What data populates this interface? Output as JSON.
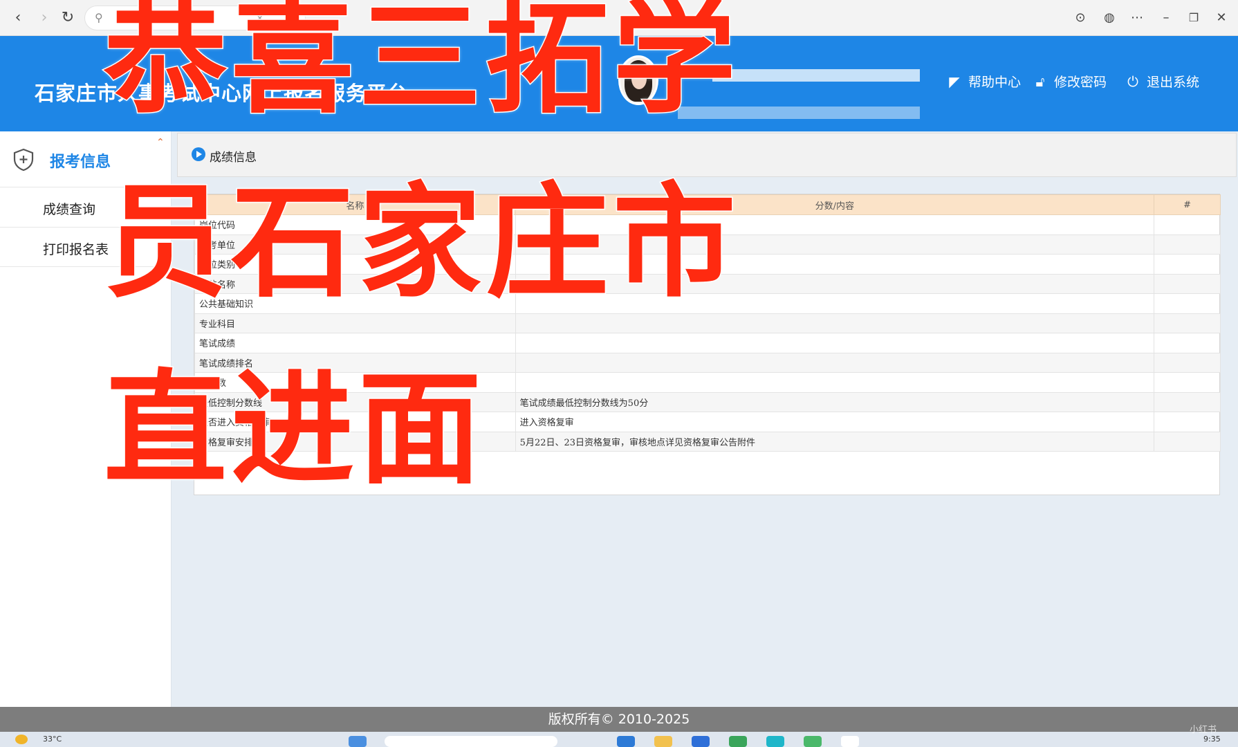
{
  "browser": {
    "nav_back": "‹",
    "nav_forward": "›",
    "nav_refresh": "↻",
    "addr_close": "×",
    "toolbar_icons": [
      "download-icon",
      "globe-icon",
      "more-icon",
      "minimize-icon",
      "restore-icon",
      "close-icon"
    ]
  },
  "header": {
    "site_title": "石家庄市人事考试中心网上报名服务平台",
    "links": [
      {
        "label": "帮助中心",
        "icon": "help-icon"
      },
      {
        "label": "修改密码",
        "icon": "lock-icon"
      },
      {
        "label": "退出系统",
        "icon": "power-icon"
      }
    ]
  },
  "sidebar": {
    "section_label": "报考信息",
    "items": [
      "成绩查询",
      "打印报名表"
    ]
  },
  "breadcrumb": {
    "label": "成绩信息"
  },
  "table": {
    "headers": [
      "名称",
      "分数/内容",
      "#"
    ],
    "rows": [
      {
        "name": "岗位代码",
        "value": ""
      },
      {
        "name": "报考单位",
        "value": ""
      },
      {
        "name": "岗位类别",
        "value": ""
      },
      {
        "name": "岗位名称",
        "value": ""
      },
      {
        "name": "公共基础知识",
        "value": ""
      },
      {
        "name": "专业科目",
        "value": ""
      },
      {
        "name": "笔试成绩",
        "value": ""
      },
      {
        "name": "笔试成绩排名",
        "value": ""
      },
      {
        "name": "岗位数",
        "value": ""
      },
      {
        "name": "最低控制分数线",
        "value": "笔试成绩最低控制分数线为50分"
      },
      {
        "name": "是否进入资格复审",
        "value": "进入资格复审"
      },
      {
        "name": "资格复审安排",
        "value": "5月22日、23日资格复审，审核地点详见资格复审公告附件"
      }
    ]
  },
  "overlay": {
    "line1": "恭喜三拓学",
    "line2": "员石家庄市",
    "line3": "直进面"
  },
  "footer": {
    "copyright": "版权所有© 2010-2025"
  },
  "taskbar": {
    "weather": "33°C",
    "time": "9:35",
    "watermark": "小红书"
  },
  "colors": {
    "header_blue": "#1e86e6",
    "overlay_red": "#ff2a10",
    "table_header": "#fbe3c8"
  }
}
